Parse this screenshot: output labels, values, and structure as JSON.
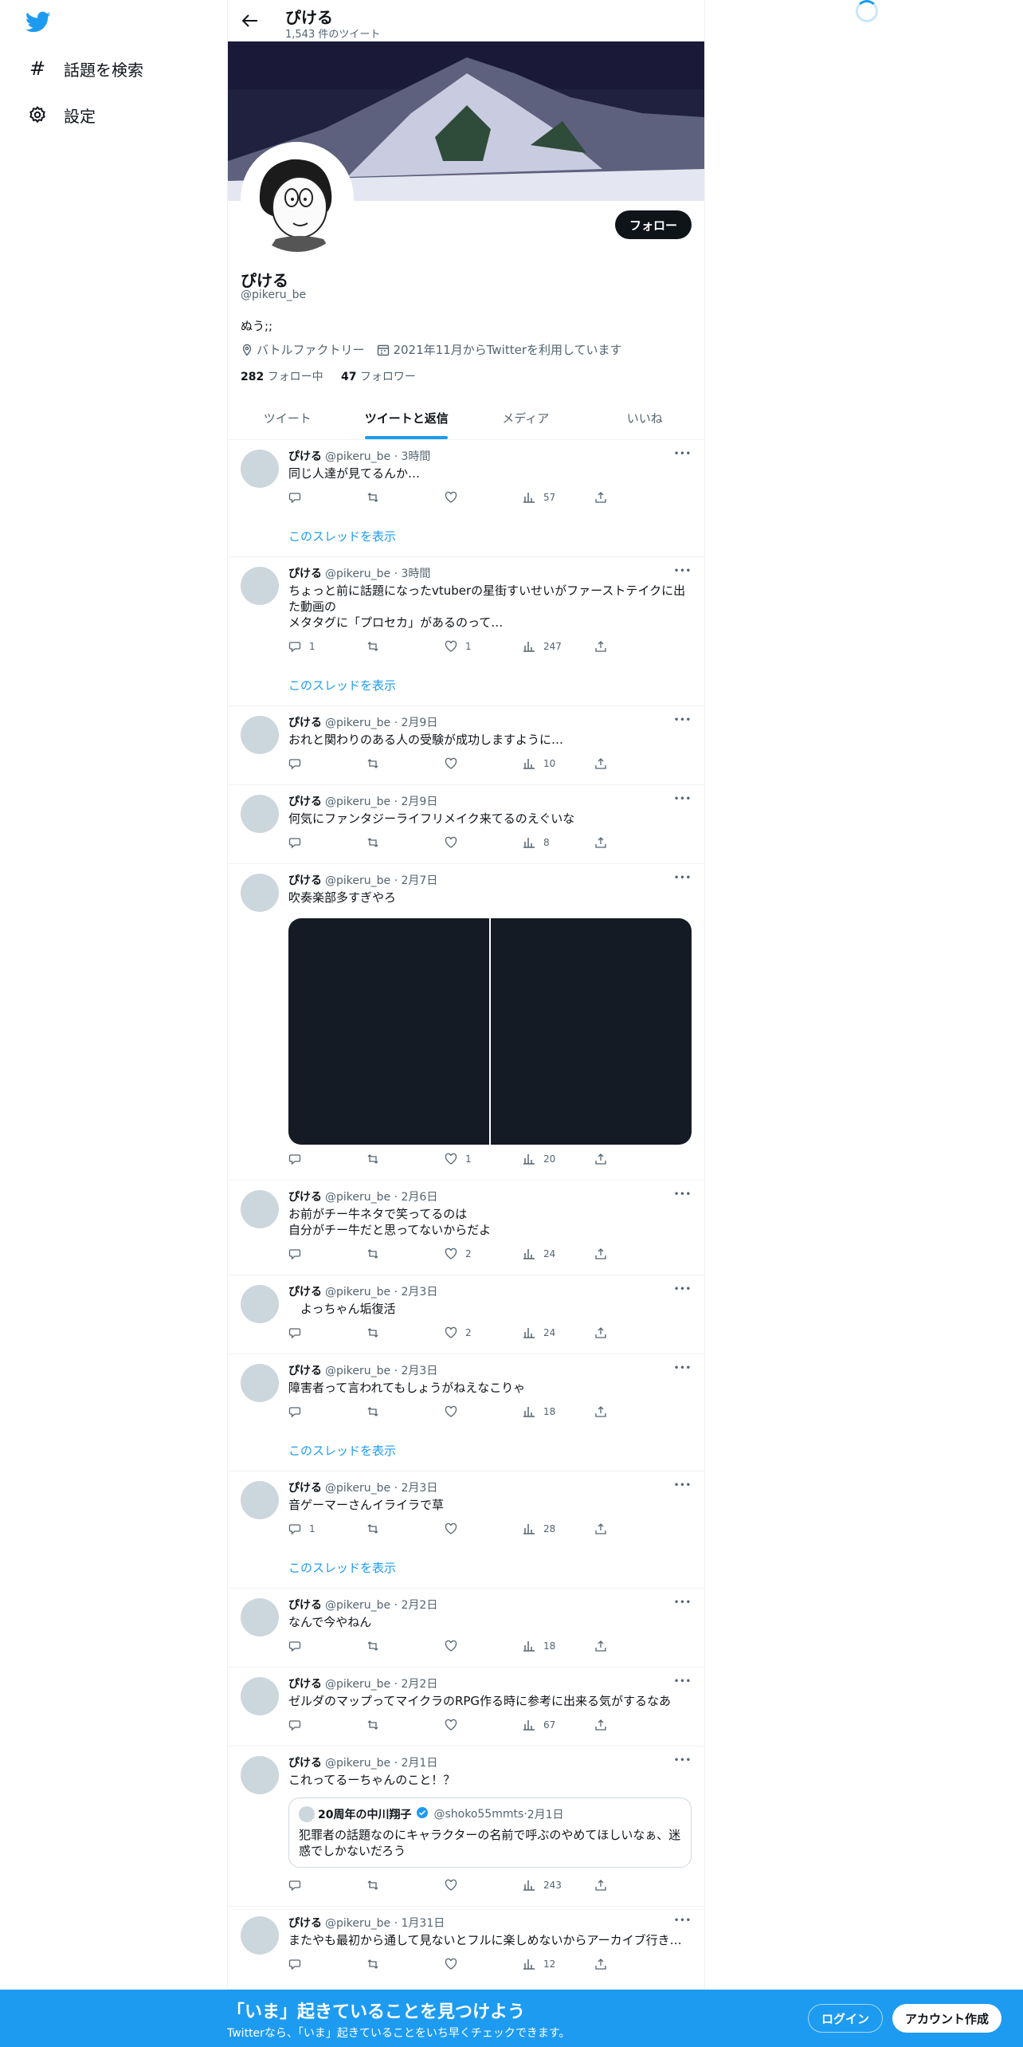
{
  "colors": {
    "accent": "#1d9bf0",
    "dark": "#0f1419",
    "muted": "#536471"
  },
  "nav": {
    "logo_icon": "twitter-bird-icon",
    "explore_label": "話題を検索",
    "settings_label": "設定"
  },
  "header": {
    "name": "ぴける",
    "tweet_count": "1,543 件のツイート"
  },
  "profile": {
    "name": "ぴける",
    "handle": "@pikeru_be",
    "bio": "ぬう;;",
    "location": "バトルファクトリー",
    "joined": "2021年11月からTwitterを利用しています",
    "following_count": "282",
    "following_label": "フォロー中",
    "followers_count": "47",
    "followers_label": "フォロワー",
    "follow_button": "フォロー"
  },
  "tabs": [
    {
      "label": "ツイート"
    },
    {
      "label": "ツイートと返信"
    },
    {
      "label": "メディア"
    },
    {
      "label": "いいね"
    }
  ],
  "thread_label": "このスレッドを表示",
  "tweets": [
    {
      "name": "ぴける",
      "handle": "@pikeru_be",
      "time": "3時間",
      "text": "同じ人達が見てるんか…",
      "replies": "",
      "retweets": "",
      "likes": "",
      "views": "57"
    },
    {
      "name": "ぴける",
      "handle": "@pikeru_be",
      "time": "3時間",
      "text": "ちょっと前に話題になったvtuberの星街すいせいがファーストテイクに出た動画の\nメタタグに「プロセカ」があるのって…",
      "replies": "1",
      "retweets": "",
      "likes": "1",
      "views": "247"
    },
    {
      "name": "ぴける",
      "handle": "@pikeru_be",
      "time": "2月9日",
      "text": "おれと関わりのある人の受験が成功しますように…",
      "replies": "",
      "retweets": "",
      "likes": "",
      "views": "10"
    },
    {
      "name": "ぴける",
      "handle": "@pikeru_be",
      "time": "2月9日",
      "text": "何気にファンタジーライフリメイク来てるのえぐいな",
      "replies": "",
      "retweets": "",
      "likes": "",
      "views": "8"
    },
    {
      "name": "ぴける",
      "handle": "@pikeru_be",
      "time": "2月7日",
      "text": "吹奏楽部多すぎやろ",
      "replies": "",
      "retweets": "",
      "likes": "1",
      "views": "20"
    },
    {
      "name": "ぴける",
      "handle": "@pikeru_be",
      "time": "2月6日",
      "text": "お前がチー牛ネタで笑ってるのは\n自分がチー牛だと思ってないからだよ",
      "replies": "",
      "retweets": "",
      "likes": "2",
      "views": "24"
    },
    {
      "name": "ぴける",
      "handle": "@pikeru_be",
      "time": "2月3日",
      "text": "　よっちゃん垢復活",
      "replies": "",
      "retweets": "",
      "likes": "2",
      "views": "24"
    },
    {
      "name": "ぴける",
      "handle": "@pikeru_be",
      "time": "2月3日",
      "text": "障害者って言われてもしょうがねえなこりゃ",
      "replies": "",
      "retweets": "",
      "likes": "",
      "views": "18"
    },
    {
      "name": "ぴける",
      "handle": "@pikeru_be",
      "time": "2月3日",
      "text": "音ゲーマーさんイライラで草",
      "replies": "1",
      "retweets": "",
      "likes": "",
      "views": "28"
    },
    {
      "name": "ぴける",
      "handle": "@pikeru_be",
      "time": "2月2日",
      "text": "なんで今やねん",
      "replies": "",
      "retweets": "",
      "likes": "",
      "views": "18"
    },
    {
      "name": "ぴける",
      "handle": "@pikeru_be",
      "time": "2月2日",
      "text": "ゼルダのマップってマイクラのRPG作る時に参考に出来る気がするなあ",
      "replies": "",
      "retweets": "",
      "likes": "",
      "views": "67"
    },
    {
      "name": "ぴける",
      "handle": "@pikeru_be",
      "time": "2月1日",
      "text": "これってるーちゃんのこと！？",
      "replies": "",
      "retweets": "",
      "likes": "",
      "views": "243"
    },
    {
      "name": "ぴける",
      "handle": "@pikeru_be",
      "time": "1月31日",
      "text": "またやも最初から通して見ないとフルに楽しめないからアーカイブ行き…",
      "replies": "",
      "retweets": "",
      "likes": "",
      "views": "12"
    }
  ],
  "quote": {
    "name": "20周年の中川翔子",
    "handle": "@shoko55mmts",
    "time": "2月1日",
    "text": "犯罪者の話題なのにキャラクターの名前で呼ぶのやめてほしいなぁ、迷惑でしかないだろう"
  },
  "bottom": {
    "title": "「いま」起きていることを見つけよう",
    "subtitle": "Twitterなら、「いま」起きていることをいち早くチェックできます。",
    "login": "ログイン",
    "signup": "アカウント作成"
  }
}
